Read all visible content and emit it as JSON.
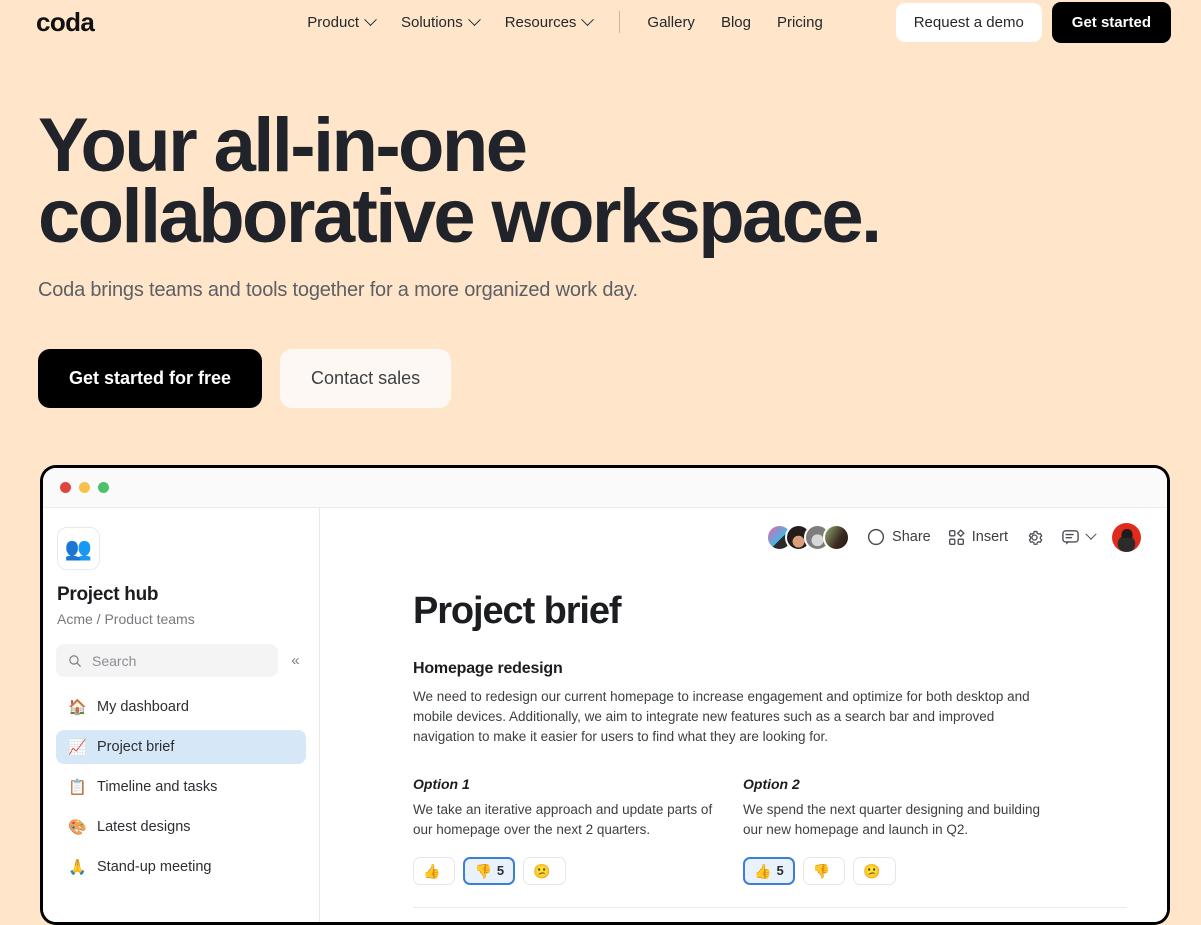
{
  "brand": {
    "logo_text": "coda"
  },
  "nav": {
    "menus": [
      {
        "label": "Product",
        "icon": "chevron-down-icon"
      },
      {
        "label": "Solutions",
        "icon": "chevron-down-icon"
      },
      {
        "label": "Resources",
        "icon": "chevron-down-icon"
      }
    ],
    "links": [
      {
        "label": "Gallery"
      },
      {
        "label": "Blog"
      },
      {
        "label": "Pricing"
      }
    ],
    "demo_label": "Request a demo",
    "get_started_label": "Get started"
  },
  "hero": {
    "heading_line1": "Your all-in-one",
    "heading_line2": "collaborative workspace.",
    "subheading": "Coda brings teams and tools together for a more organized work day.",
    "primary_cta": "Get started for free",
    "secondary_cta": "Contact sales"
  },
  "app": {
    "window_dots": [
      "red",
      "yellow",
      "green"
    ],
    "sidebar": {
      "app_icon": "👥",
      "workspace_title": "Project hub",
      "workspace_breadcrumb": "Acme / Product teams",
      "search_placeholder": "Search",
      "search_value": "",
      "collapse_icon": "«",
      "items": [
        {
          "emoji": "🏠",
          "label": "My dashboard",
          "active": false
        },
        {
          "emoji": "📈",
          "label": "Project brief",
          "active": true
        },
        {
          "emoji": "📋",
          "label": "Timeline and tasks",
          "active": false
        },
        {
          "emoji": "🎨",
          "label": "Latest designs",
          "active": false
        },
        {
          "emoji": "🙏",
          "label": "Stand-up meeting",
          "active": false
        }
      ]
    },
    "toolbar": {
      "share_label": "Share",
      "insert_label": "Insert",
      "settings_icon": "gear-icon",
      "comment_icon": "comment-icon",
      "collaborator_count": 4
    },
    "doc": {
      "title": "Project brief",
      "section_heading": "Homepage redesign",
      "section_body": "We need to redesign our current homepage to increase engagement and optimize for both desktop and mobile devices. Additionally, we aim to integrate new features such as a search bar and improved navigation to make it easier for users to find what they are looking for.",
      "options": [
        {
          "title": "Option 1",
          "body": "We take an iterative approach and update parts of our homepage over the next 2 quarters.",
          "reactions": [
            {
              "emoji": "👍",
              "count": "",
              "selected": false
            },
            {
              "emoji": "👎",
              "count": "5",
              "selected": true
            },
            {
              "emoji": "😕",
              "count": "",
              "selected": false
            }
          ]
        },
        {
          "title": "Option 2",
          "body": "We spend the next quarter designing and building our new homepage and launch in Q2.",
          "reactions": [
            {
              "emoji": "👍",
              "count": "5",
              "selected": true
            },
            {
              "emoji": "👎",
              "count": "",
              "selected": false
            },
            {
              "emoji": "😕",
              "count": "",
              "selected": false
            }
          ]
        }
      ]
    }
  },
  "colors": {
    "page_background": "#ffe6ca",
    "accent_dark": "#000000",
    "sidebar_active": "#d6e8f7",
    "reaction_selected_border": "#3b7fd4"
  }
}
